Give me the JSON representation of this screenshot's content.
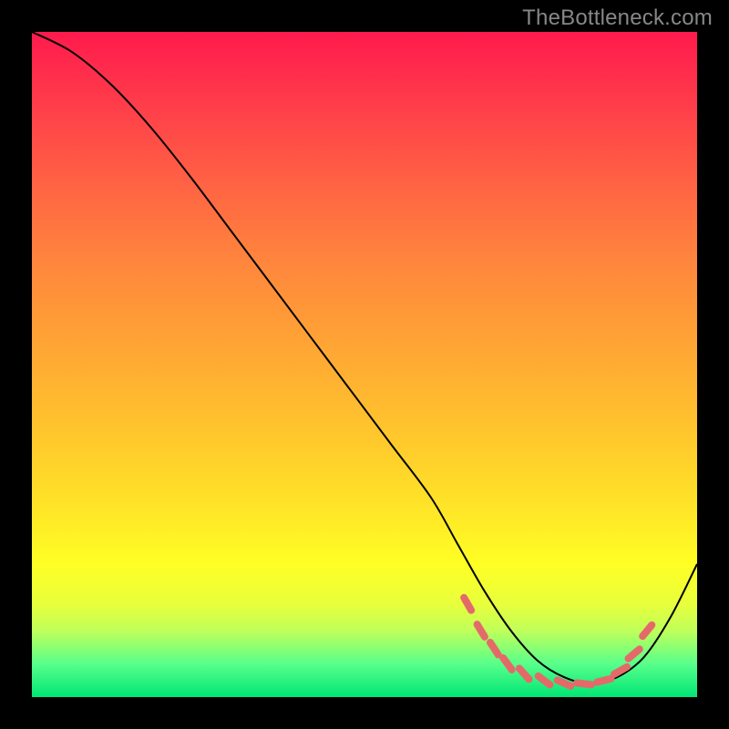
{
  "watermark": "TheBottleneck.com",
  "chart_data": {
    "type": "line",
    "title": "",
    "xlabel": "",
    "ylabel": "",
    "xlim": [
      0,
      100
    ],
    "ylim": [
      0,
      100
    ],
    "grid": false,
    "series": [
      {
        "name": "bottleneck-curve",
        "x": [
          0,
          6,
          12,
          18,
          24,
          30,
          36,
          42,
          48,
          54,
          60,
          64,
          68,
          72,
          76,
          80,
          84,
          88,
          92,
          96,
          100
        ],
        "values": [
          100,
          97,
          92,
          85.5,
          78,
          70,
          62,
          54,
          46,
          38,
          30,
          23,
          16,
          10,
          5.5,
          3,
          2,
          3,
          6,
          12,
          20
        ]
      }
    ],
    "annotations": {
      "optimal_band_dashes": [
        {
          "x": 65.5,
          "y": 14.0
        },
        {
          "x": 67.5,
          "y": 10.0
        },
        {
          "x": 69.5,
          "y": 7.3
        },
        {
          "x": 71.5,
          "y": 5.0
        },
        {
          "x": 74.0,
          "y": 3.5
        },
        {
          "x": 77.0,
          "y": 2.5
        },
        {
          "x": 80.0,
          "y": 2.1
        },
        {
          "x": 83.0,
          "y": 2.0
        },
        {
          "x": 86.0,
          "y": 2.5
        },
        {
          "x": 88.5,
          "y": 4.0
        },
        {
          "x": 90.5,
          "y": 6.5
        },
        {
          "x": 92.5,
          "y": 10.0
        }
      ]
    }
  }
}
